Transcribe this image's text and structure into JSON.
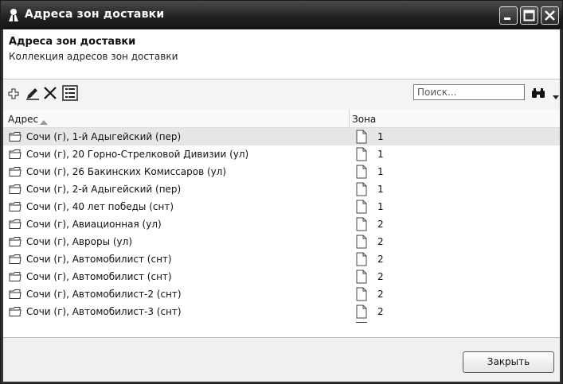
{
  "window": {
    "title": "Адреса зон доставки"
  },
  "header": {
    "title": "Адреса зон доставки",
    "subtitle": "Коллекция адресов зон доставки"
  },
  "toolbar": {
    "search_placeholder": "Поиск...",
    "icons": [
      "add-icon",
      "edit-icon",
      "delete-icon",
      "details-icon",
      "binoculars-icon",
      "dropdown-arrow-icon"
    ]
  },
  "grid": {
    "columns": [
      "Адрес",
      "Зона"
    ],
    "rows": [
      {
        "address": "Сочи (г), 1-й Адыгейский (пер)",
        "zone": "1",
        "selected": true
      },
      {
        "address": "Сочи (г), 20 Горно-Стрелковой Дивизии (ул)",
        "zone": "1"
      },
      {
        "address": "Сочи (г), 26 Бакинских Комиссаров (ул)",
        "zone": "1"
      },
      {
        "address": "Сочи (г), 2-й Адыгейский (пер)",
        "zone": "1"
      },
      {
        "address": "Сочи (г), 40 лет победы (снт)",
        "zone": "1"
      },
      {
        "address": "Сочи (г), Авиационная (ул)",
        "zone": "2"
      },
      {
        "address": "Сочи (г), Авроры (ул)",
        "zone": "2"
      },
      {
        "address": "Сочи (г), Автомобилист (снт)",
        "zone": "2"
      },
      {
        "address": "Сочи (г), Автомобилист (снт)",
        "zone": "2"
      },
      {
        "address": "Сочи (г), Автомобилист-2 (снт)",
        "zone": "2"
      },
      {
        "address": "Сочи (г), Автомобилист-3 (снт)",
        "zone": "2"
      }
    ]
  },
  "footer": {
    "close_label": "Закрыть"
  }
}
